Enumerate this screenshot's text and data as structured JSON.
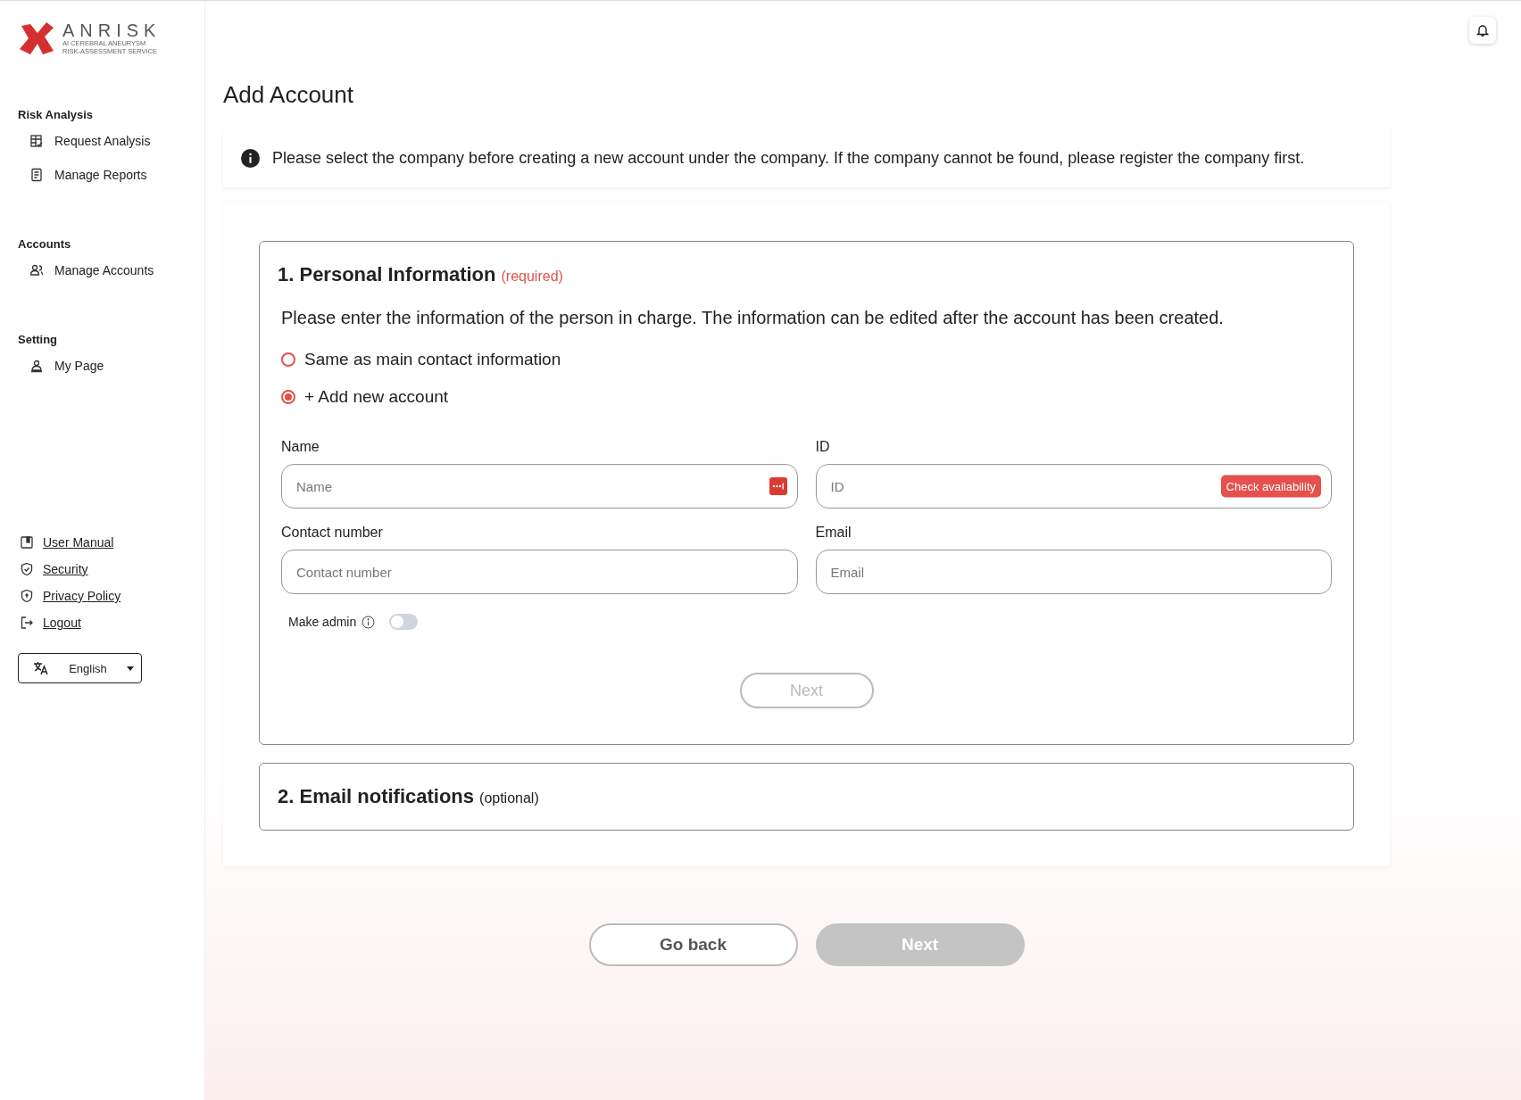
{
  "brand": {
    "name": "ANRISK",
    "tagline": [
      "AI CEREBRAL ANEURYSM",
      "RISK-ASSESSMENT SERVICE"
    ]
  },
  "sidebar": {
    "sections": [
      {
        "title": "Risk Analysis",
        "items": [
          {
            "label": "Request Analysis"
          },
          {
            "label": "Manage Reports"
          }
        ]
      },
      {
        "title": "Accounts",
        "items": [
          {
            "label": "Manage Accounts"
          }
        ]
      },
      {
        "title": "Setting",
        "items": [
          {
            "label": "My Page"
          }
        ]
      }
    ],
    "links": [
      {
        "label": "User Manual"
      },
      {
        "label": "Security"
      },
      {
        "label": "Privacy Policy"
      },
      {
        "label": "Logout"
      }
    ],
    "language": "English"
  },
  "page": {
    "title": "Add Account",
    "notice": "Please select the company before creating a new account under the company. If the company cannot be found, please register the company first."
  },
  "sections": [
    {
      "title": "1. Personal Information",
      "tag": "(required)",
      "expanded": true,
      "description": "Please enter the information of the person in charge. The information can be edited after the account has been created.",
      "options": [
        {
          "label": "Same as main contact information",
          "selected": false
        },
        {
          "label": "+ Add new account",
          "selected": true
        }
      ],
      "fields": [
        {
          "label": "Name",
          "placeholder": "Name",
          "kind": "autofill"
        },
        {
          "label": "ID",
          "placeholder": "ID",
          "kind": "check",
          "action": "Check availability"
        },
        {
          "label": "Contact number",
          "placeholder": "Contact number",
          "kind": "plain"
        },
        {
          "label": "Email",
          "placeholder": "Email",
          "kind": "plain"
        }
      ],
      "admin": {
        "label": "Make admin",
        "on": false
      },
      "next": {
        "label": "Next",
        "disabled": true
      }
    },
    {
      "title": "2. Email notifications",
      "tag": "(optional)",
      "expanded": false
    }
  ],
  "footer": {
    "back": "Go back",
    "next": {
      "label": "Next",
      "disabled": true
    }
  }
}
